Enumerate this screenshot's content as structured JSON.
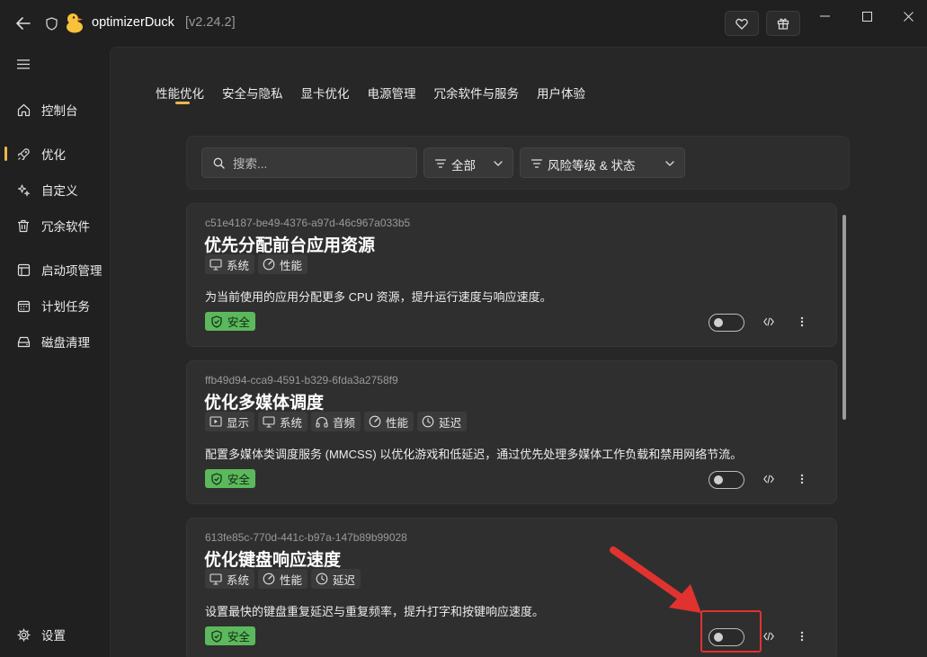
{
  "window": {
    "app_name": "optimizerDuck",
    "version": "[v2.24.2]"
  },
  "sidebar": {
    "items": [
      {
        "label": "控制台",
        "icon": "home-icon"
      },
      {
        "label": "优化",
        "icon": "rocket-icon",
        "active": true
      },
      {
        "label": "自定义",
        "icon": "sparkle-icon"
      },
      {
        "label": "冗余软件",
        "icon": "trash-icon"
      },
      {
        "label": "启动项管理",
        "icon": "startup-icon"
      },
      {
        "label": "计划任务",
        "icon": "calendar-icon"
      },
      {
        "label": "磁盘清理",
        "icon": "disk-icon"
      }
    ],
    "settings_label": "设置"
  },
  "tabs": [
    {
      "label": "性能优化",
      "active": true
    },
    {
      "label": "安全与隐私"
    },
    {
      "label": "显卡优化"
    },
    {
      "label": "电源管理"
    },
    {
      "label": "冗余软件与服务"
    },
    {
      "label": "用户体验"
    }
  ],
  "filters": {
    "search_placeholder": "搜索...",
    "category_label": "全部",
    "risk_label": "风险等级 & 状态"
  },
  "cards": [
    {
      "id": "c51e4187-be49-4376-a97d-46c967a033b5",
      "title": "优先分配前台应用资源",
      "tags": [
        {
          "label": "系统",
          "icon": "monitor-icon"
        },
        {
          "label": "性能",
          "icon": "gauge-icon"
        }
      ],
      "description": "为当前使用的应用分配更多 CPU 资源，提升运行速度与响应速度。",
      "risk": "安全",
      "enabled": false
    },
    {
      "id": "ffb49d94-cca9-4591-b329-6fda3a2758f9",
      "title": "优化多媒体调度",
      "tags": [
        {
          "label": "显示",
          "icon": "play-icon"
        },
        {
          "label": "系统",
          "icon": "monitor-icon"
        },
        {
          "label": "音频",
          "icon": "headphones-icon"
        },
        {
          "label": "性能",
          "icon": "gauge-icon"
        },
        {
          "label": "延迟",
          "icon": "clock-icon"
        }
      ],
      "description": "配置多媒体类调度服务 (MMCSS) 以优化游戏和低延迟，通过优先处理多媒体工作负载和禁用网络节流。",
      "risk": "安全",
      "enabled": false
    },
    {
      "id": "613fe85c-770d-441c-b97a-147b89b99028",
      "title": "优化键盘响应速度",
      "tags": [
        {
          "label": "系统",
          "icon": "monitor-icon"
        },
        {
          "label": "性能",
          "icon": "gauge-icon"
        },
        {
          "label": "延迟",
          "icon": "clock-icon"
        }
      ],
      "description": "设置最快的键盘重复延迟与重复频率，提升打字和按键响应速度。",
      "risk": "安全",
      "enabled": false
    }
  ],
  "colors": {
    "accent": "#e8b84a",
    "safe_badge": "#5cb85c",
    "highlight": "#e0332f"
  }
}
